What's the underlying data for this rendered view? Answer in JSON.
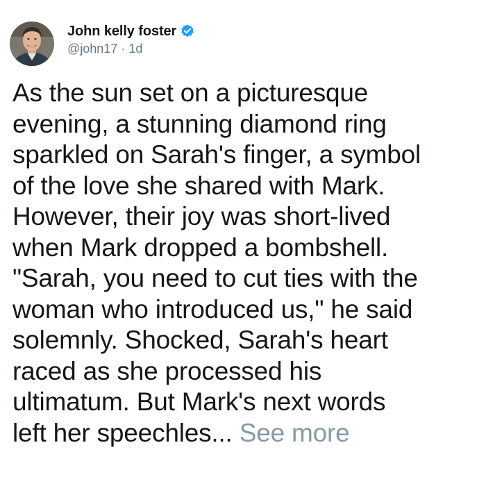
{
  "tweet": {
    "author": {
      "display_name": "John kelly foster",
      "handle": "@john17",
      "separator": " · ",
      "time": "1d",
      "verified": true,
      "avatar_icon": "profile-photo"
    },
    "body_lines": [
      "As the sun set on a picturesque",
      "evening, a stunning diamond ring",
      "sparkled on Sarah's finger, a symbol",
      "of the love she shared with Mark.",
      "However, their joy was short-lived",
      "when Mark dropped a bombshell.",
      "\"Sarah, you need to cut ties with the",
      "woman who introduced us,\" he said",
      "solemnly. Shocked, Sarah's heart",
      "raced as she processed his",
      "ultimatum. But Mark's next words",
      "left her speechles... "
    ],
    "see_more_label": "See more"
  },
  "colors": {
    "text": "#14171a",
    "muted": "#657786",
    "see_more": "#8899a6",
    "verified_badge": "#1da1f2"
  }
}
